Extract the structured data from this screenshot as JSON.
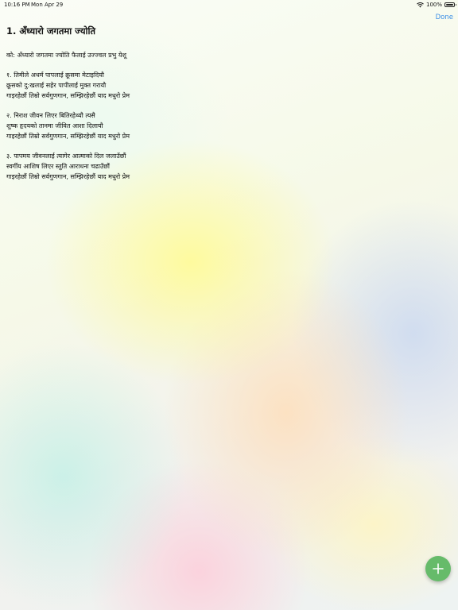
{
  "status_bar": {
    "time": "10:16 PM",
    "date": "Mon Apr 29",
    "battery_text": "100%"
  },
  "toolbar": {
    "done_label": "Done"
  },
  "song": {
    "title": "1. अँध्यारो जगतमा ज्योति",
    "verses": [
      {
        "lines": [
          "को: अँध्यारो जगतमा ज्योति फैलाई उज्ज्वल प्रभु येशू"
        ]
      },
      {
        "lines": [
          "१. तिमीले अधर्म पापलाई क्रूसमा मेटाइदियौ",
          "क्रूसको दु:खलाई सहेर पापीलाई मुक्त गरायौ",
          "गाइरहेछौं तिम्रो सर्वगुणगान, सम्झिरहेछौं याद मधुरो प्रेम"
        ]
      },
      {
        "lines": [
          "२. निराश जीवन लिएर बितिरहेथ्यौ त्यसै",
          "शुष्क हृदयको तानमा जीवित आशा दिलायौ",
          "गाइरहेछौं तिम्रो सर्वगुणगान, सम्झिरहेछौं याद मधुरो प्रेम"
        ]
      },
      {
        "lines": [
          "३. पापमय जीवनलाई त्यागेर आत्माको दिल जलाउँछौं",
          "स्वर्गीय आशिष लिएर स्तुति आराधना चढाउँछौं",
          "गाइरहेछौं तिम्रो सर्वगुणगान, सम्झिरहेछौं याद मधुरो प्रेम"
        ]
      }
    ]
  },
  "icons": {
    "wifi": "wifi-icon",
    "battery": "battery-icon",
    "add": "plus-icon"
  },
  "colors": {
    "accent": "#3a8ee6",
    "fab": "#66bb6a"
  }
}
